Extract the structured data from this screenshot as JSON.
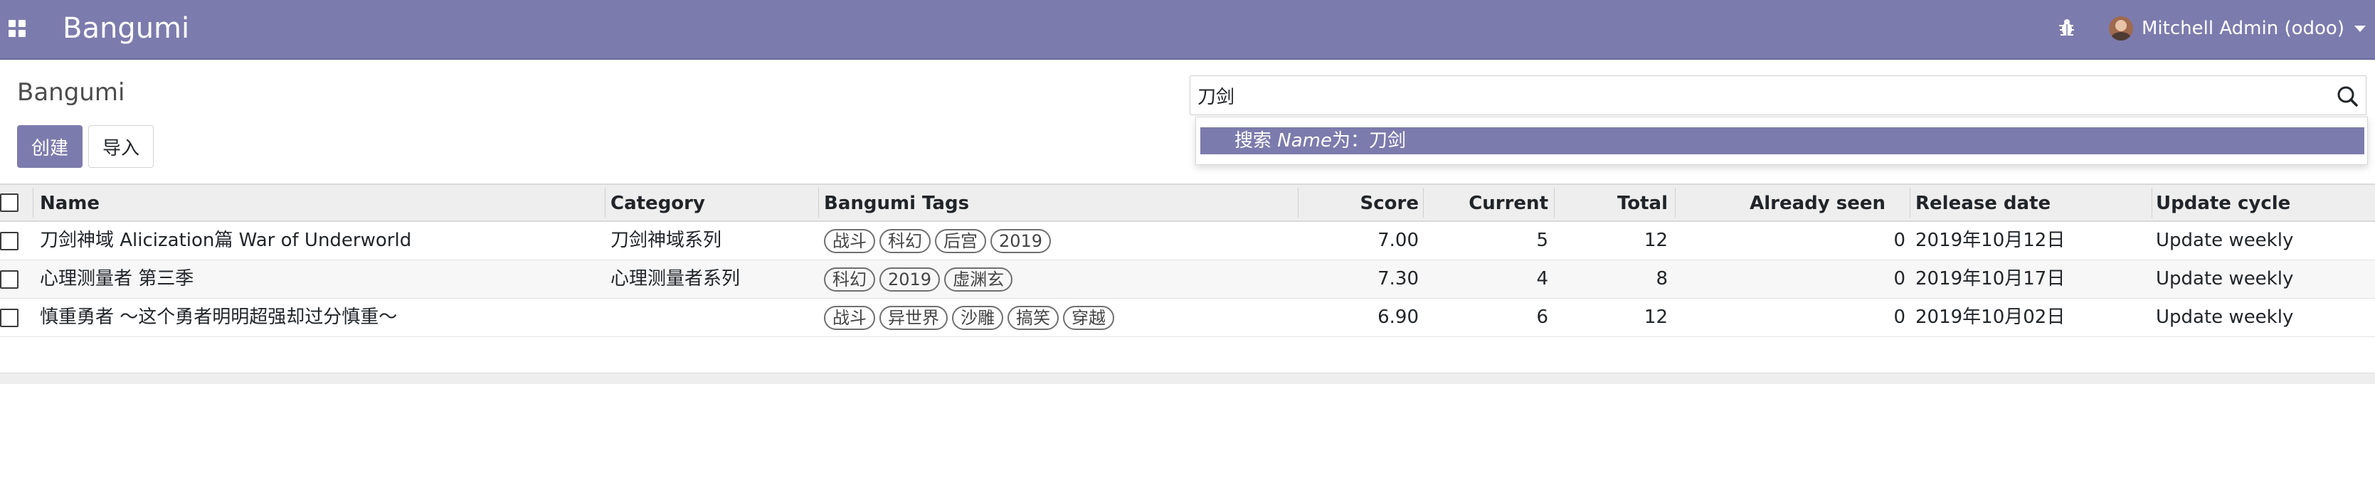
{
  "navbar": {
    "app_name": "Bangumi",
    "user_name": "Mitchell Admin (odoo)",
    "color": "#7c7bad"
  },
  "control_panel": {
    "breadcrumb": "Bangumi",
    "create_label": "创建",
    "import_label": "导入"
  },
  "search": {
    "value": "刀剑",
    "autocomplete": {
      "prefix": "搜索 ",
      "field": "Name",
      "suffix": "为：刀剑"
    }
  },
  "table": {
    "headers": {
      "name": "Name",
      "category": "Category",
      "tags": "Bangumi Tags",
      "score": "Score",
      "current": "Current",
      "total": "Total",
      "seen": "Already seen",
      "release": "Release date",
      "cycle": "Update cycle"
    },
    "rows": [
      {
        "name": "刀剑神域 Alicization篇 War of Underworld",
        "category": "刀剑神域系列",
        "tags": [
          "战斗",
          "科幻",
          "后宫",
          "2019"
        ],
        "score": "7.00",
        "current": "5",
        "total": "12",
        "seen": "0",
        "release": "2019年10月12日",
        "cycle": "Update weekly"
      },
      {
        "name": "心理测量者 第三季",
        "category": "心理测量者系列",
        "tags": [
          "科幻",
          "2019",
          "虚渊玄"
        ],
        "score": "7.30",
        "current": "4",
        "total": "8",
        "seen": "0",
        "release": "2019年10月17日",
        "cycle": "Update weekly"
      },
      {
        "name": "慎重勇者 ～这个勇者明明超强却过分慎重～",
        "category": "",
        "tags": [
          "战斗",
          "异世界",
          "沙雕",
          "搞笑",
          "穿越"
        ],
        "score": "6.90",
        "current": "6",
        "total": "12",
        "seen": "0",
        "release": "2019年10月02日",
        "cycle": "Update weekly"
      }
    ]
  }
}
